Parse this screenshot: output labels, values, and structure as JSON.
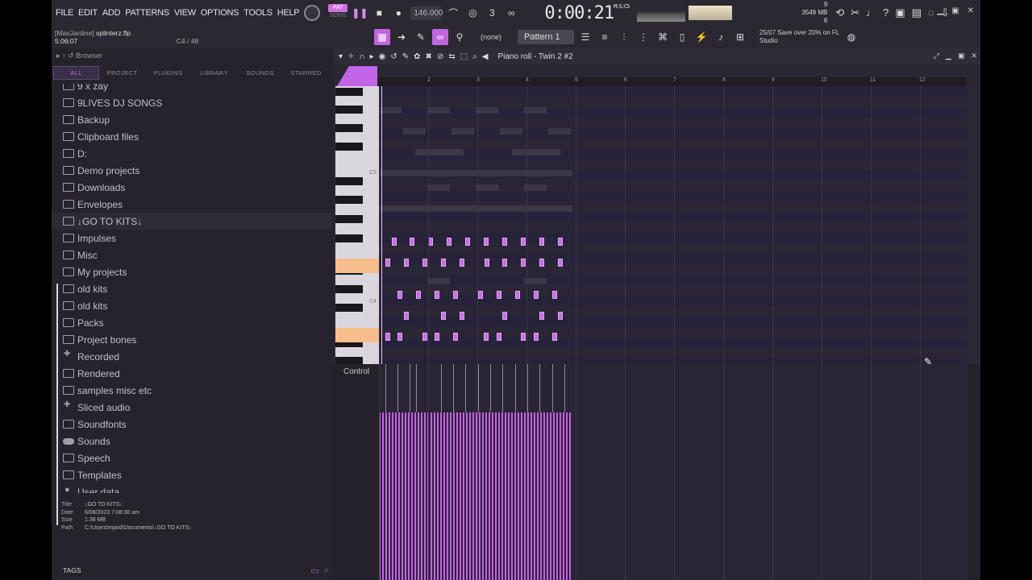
{
  "menu": [
    "FILE",
    "EDIT",
    "ADD",
    "PATTERNS",
    "VIEW",
    "OPTIONS",
    "TOOLS",
    "HELP"
  ],
  "transport": {
    "pat": "PAT",
    "song": "SONG",
    "bpm": "146.000",
    "time": "0:00:21",
    "time_unit": "M:S:CS"
  },
  "memory": {
    "mb": "3549 MB",
    "val1": "9",
    "val2": "6"
  },
  "project": {
    "user": "[MaxJardine]",
    "file": "splinterz.flp",
    "time": "5:06:07",
    "note": "C4 / 48"
  },
  "snap": "(none)",
  "pattern": "Pattern 1",
  "news": {
    "date": "25/07",
    "text": "Save over 20% on FL Studio"
  },
  "browser": {
    "title": "Browser",
    "tabs": [
      "ALL",
      "PROJECT",
      "PLUGINS",
      "LIBRARY",
      "SOUNDS",
      "STARRED"
    ],
    "items": [
      "9 x zay",
      "9LIVES DJ SONGS",
      "Backup",
      "Clipboard files",
      "D:",
      "Demo projects",
      "Downloads",
      "Envelopes",
      "↓GO TO KITS↓",
      "Impulses",
      "Misc",
      "My projects",
      "old kits",
      "old kits",
      "Packs",
      "Project bones",
      "Recorded",
      "Rendered",
      "samples misc etc",
      "Sliced audio",
      "Soundfonts",
      "Sounds",
      "Speech",
      "Templates",
      "User data"
    ],
    "info": {
      "title_k": "Title",
      "title_v": "↓GO TO KITS↓",
      "date_k": "Date",
      "date_v": "6/08/2023 7:08:30 am",
      "size_k": "Size",
      "size_v": "1.38 MB",
      "path_k": "Path",
      "path_v": "C:\\Users\\mjard\\Documents\\↓GO TO KITS↓"
    },
    "tags": "TAGS"
  },
  "pianoroll": {
    "title": "Piano roll - Twin 2 #2",
    "control": "Control",
    "bars": [
      "2",
      "3",
      "4",
      "5",
      "6",
      "7",
      "8",
      "9",
      "10",
      "11",
      "12"
    ],
    "key_c5": "C5",
    "key_c4": "C4"
  }
}
